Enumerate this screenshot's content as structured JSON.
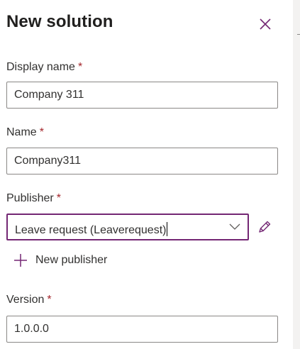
{
  "panel": {
    "title": "New solution",
    "close_icon": "close-icon"
  },
  "display_name": {
    "label": "Display name",
    "required_mark": "*",
    "value": "Company 311"
  },
  "name": {
    "label": "Name",
    "required_mark": "*",
    "value": "Company311"
  },
  "publisher": {
    "label": "Publisher",
    "required_mark": "*",
    "selected": "Leave request (Leaverequest)",
    "chevron_icon": "chevron-down-icon",
    "edit_icon": "pencil-icon",
    "new_publisher_label": "New publisher",
    "new_publisher_icon": "plus-icon"
  },
  "version": {
    "label": "Version",
    "required_mark": "*",
    "value": "1.0.0.0"
  },
  "colors": {
    "accent": "#742774",
    "required": "#a4262c",
    "border": "#8a8886",
    "text": "#323130"
  }
}
